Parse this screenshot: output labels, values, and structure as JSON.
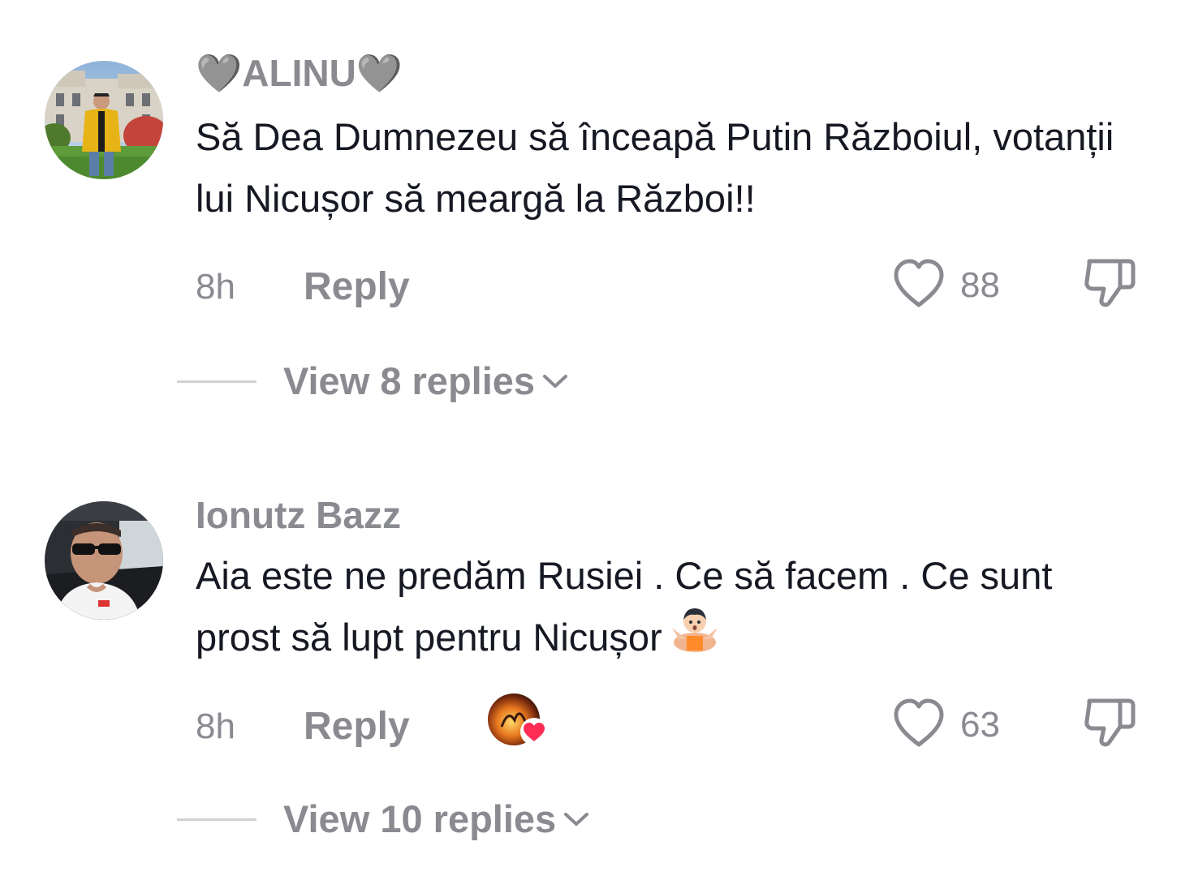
{
  "comments": [
    {
      "username": "🩶ALINU🩶",
      "text": "Să Dea Dumnezeu să înceapă Putin Războiul, votanții lui Nicușor să meargă la Război!!",
      "time": "8h",
      "reply_label": "Reply",
      "likes": "88",
      "view_replies_label": "View 8 replies",
      "avatar_icon": "avatar-photo",
      "like_icon": "heart-outline-icon",
      "dislike_icon": "thumbs-down-icon"
    },
    {
      "username": "Ionutz Bazz",
      "text": "Aia este ne predăm Rusiei . Ce să facem . Ce sunt prost să lupt pentru Nicușor",
      "emoji": "man-shrugging-emoji",
      "time": "8h",
      "reply_label": "Reply",
      "likes": "63",
      "creator_liked": true,
      "view_replies_label": "View 10 replies",
      "avatar_icon": "avatar-photo",
      "like_icon": "heart-outline-icon",
      "dislike_icon": "thumbs-down-icon"
    }
  ],
  "colors": {
    "text_primary": "#161823",
    "text_secondary": "#8a8b91",
    "divider": "#d0d1d3",
    "heart_red": "#fe2c55"
  }
}
